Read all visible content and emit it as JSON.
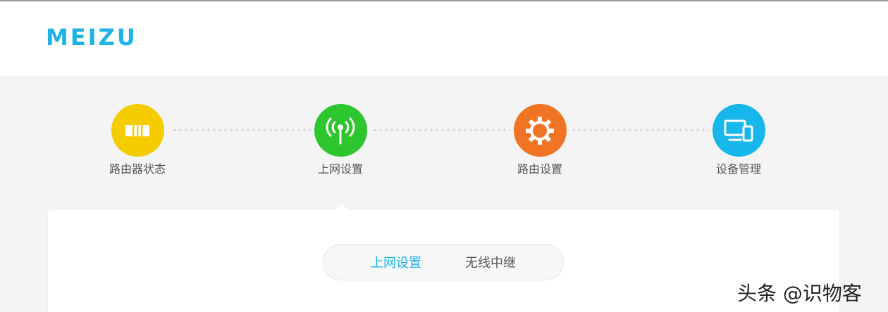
{
  "brand": {
    "logo_text": "MEIZU",
    "color": "#1fb3e6"
  },
  "steps": [
    {
      "label": "路由器状态",
      "icon": "router-status-icon",
      "color": "#f5cc00"
    },
    {
      "label": "上网设置",
      "icon": "antenna-icon",
      "color": "#2ec62e"
    },
    {
      "label": "路由设置",
      "icon": "gear-icon",
      "color": "#f07424"
    },
    {
      "label": "设备管理",
      "icon": "devices-icon",
      "color": "#17b7eb"
    }
  ],
  "tabs": [
    {
      "label": "上网设置",
      "active": true
    },
    {
      "label": "无线中继",
      "active": false
    }
  ],
  "watermark": "头条 @识物客"
}
